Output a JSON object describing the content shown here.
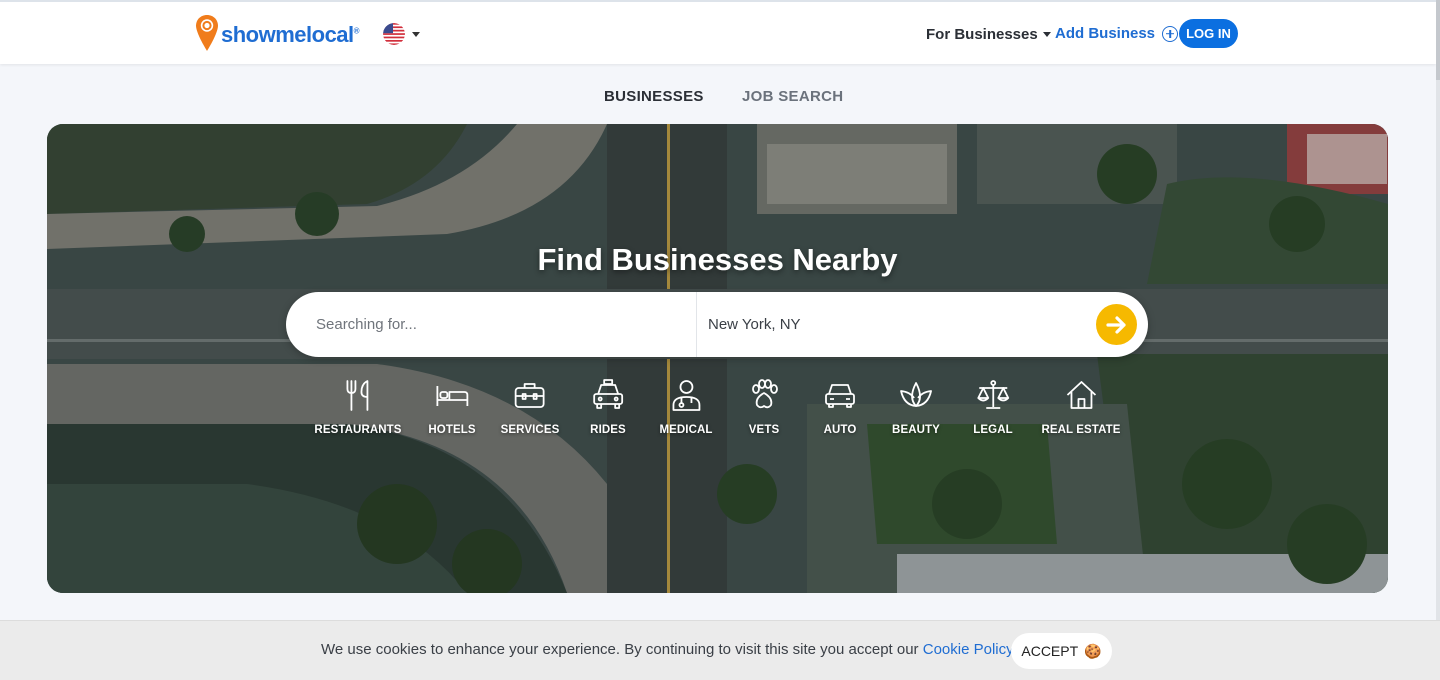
{
  "header": {
    "brand": "showmelocal",
    "brand_reg": "®",
    "for_businesses": "For Businesses",
    "add_business": "Add Business",
    "login": "LOG IN"
  },
  "tabs": [
    {
      "label": "BUSINESSES",
      "active": true
    },
    {
      "label": "JOB SEARCH",
      "active": false
    }
  ],
  "hero": {
    "title": "Find Businesses Nearby",
    "search_placeholder": "Searching for...",
    "location_value": "New York, NY",
    "categories": [
      {
        "label": "RESTAURANTS",
        "icon": "fork-knife-icon"
      },
      {
        "label": "HOTELS",
        "icon": "bed-icon"
      },
      {
        "label": "SERVICES",
        "icon": "toolbox-icon"
      },
      {
        "label": "RIDES",
        "icon": "taxi-icon"
      },
      {
        "label": "MEDICAL",
        "icon": "doctor-icon"
      },
      {
        "label": "VETS",
        "icon": "paw-icon"
      },
      {
        "label": "AUTO",
        "icon": "car-icon"
      },
      {
        "label": "BEAUTY",
        "icon": "lotus-icon"
      },
      {
        "label": "LEGAL",
        "icon": "scales-icon"
      },
      {
        "label": "REAL ESTATE",
        "icon": "house-icon"
      }
    ]
  },
  "cookie": {
    "text": "We use cookies to enhance your experience. By continuing to visit this site you accept our",
    "link": "Cookie Policy",
    "accept": "ACCEPT",
    "accept_icon": "🍪"
  },
  "colors": {
    "brand_blue": "#1f6dd2",
    "login_blue": "#0b6fe0",
    "go_yellow": "#f6b900",
    "logo_orange": "#f07c1b"
  }
}
